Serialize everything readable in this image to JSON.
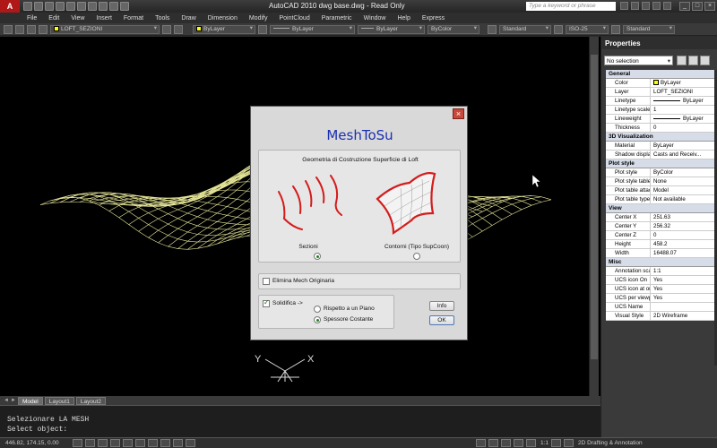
{
  "titlebar": {
    "logo": "A",
    "title": "AutoCAD 2010    dwg base.dwg - Read Only",
    "search_placeholder": "Type a keyword or phrase"
  },
  "menu": [
    "File",
    "Edit",
    "View",
    "Insert",
    "Format",
    "Tools",
    "Draw",
    "Dimension",
    "Modify",
    "PointCloud",
    "Parametric",
    "Window",
    "Help",
    "Express"
  ],
  "toolbar": {
    "layer": "LOFT_SEZIONI",
    "color": "ByLayer",
    "linetype": "ByLayer",
    "lineweight": "ByLayer",
    "plotstyle": "ByColor",
    "textstyle": "Standard",
    "dimstyle": "ISO-25",
    "tablestyle": "Standard"
  },
  "layout_tabs": [
    "Model",
    "Layout1",
    "Layout2"
  ],
  "command_lines": [
    "Selezionare LA MESH",
    "Select object:"
  ],
  "status": {
    "coords": "446.82, 174.15, 0.00",
    "scale": "1:1",
    "workspace": "2D Drafting & Annotation"
  },
  "properties": {
    "title": "Properties",
    "selection": "No selection",
    "categories": [
      {
        "name": "General",
        "rows": [
          {
            "name": "Color",
            "value": "ByLayer"
          },
          {
            "name": "Layer",
            "value": "LOFT_SEZIONI"
          },
          {
            "name": "Linetype",
            "value": "ByLayer"
          },
          {
            "name": "Linetype scale",
            "value": "1"
          },
          {
            "name": "Lineweight",
            "value": "ByLayer"
          },
          {
            "name": "Thickness",
            "value": "0"
          }
        ]
      },
      {
        "name": "3D Visualization",
        "rows": [
          {
            "name": "Material",
            "value": "ByLayer"
          },
          {
            "name": "Shadow display",
            "value": "Casts and Receiv..."
          }
        ]
      },
      {
        "name": "Plot style",
        "rows": [
          {
            "name": "Plot style",
            "value": "ByColor"
          },
          {
            "name": "Plot style table",
            "value": "None"
          },
          {
            "name": "Plot table attac...",
            "value": "Model"
          },
          {
            "name": "Plot table type",
            "value": "Not available"
          }
        ]
      },
      {
        "name": "View",
        "rows": [
          {
            "name": "Center X",
            "value": "251.63"
          },
          {
            "name": "Center Y",
            "value": "256.32"
          },
          {
            "name": "Center Z",
            "value": "0"
          },
          {
            "name": "Height",
            "value": "458.2"
          },
          {
            "name": "Width",
            "value": "16488.07"
          }
        ]
      },
      {
        "name": "Misc",
        "rows": [
          {
            "name": "Annotation scale",
            "value": "1:1"
          },
          {
            "name": "UCS icon On",
            "value": "Yes"
          },
          {
            "name": "UCS icon at origin",
            "value": "Yes"
          },
          {
            "name": "UCS per viewport",
            "value": "Yes"
          },
          {
            "name": "UCS Name",
            "value": ""
          },
          {
            "name": "Visual Style",
            "value": "2D Wireframe"
          }
        ]
      }
    ]
  },
  "dialog": {
    "title": "MeshToSu",
    "subtitle": "Geometria di Costruzione Superficie di Loft",
    "option_left": "Sezioni",
    "option_right": "Contorni (Tipo SupCoon)",
    "elimina_label": "Elimina Mech Originaria",
    "solidifica_label": "Solidifica ->",
    "radio_piano": "Rispetto a un Piano",
    "radio_spessore": "Spessore Costante",
    "info_label": "Info",
    "ok_label": "OK"
  },
  "ucs": {
    "x_label": "X",
    "y_label": "Y"
  },
  "colors": {
    "mesh": "#e8e89a",
    "canvas": "#000000",
    "accent_red": "#d41c1c",
    "dialog_title": "#1a2fb0"
  }
}
